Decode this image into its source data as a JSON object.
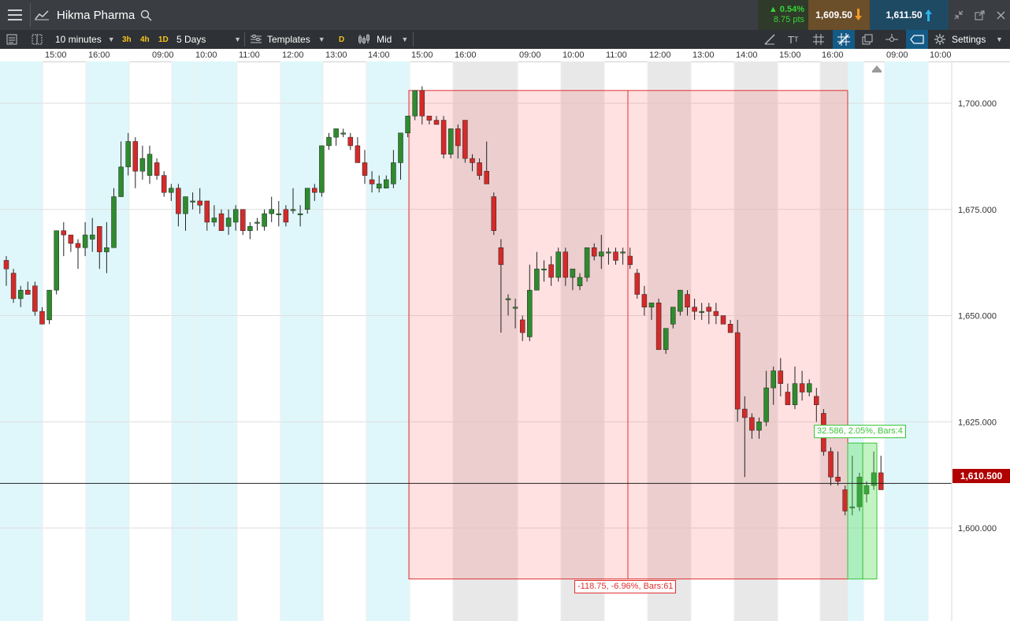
{
  "instrument": {
    "name": "Hikma Pharma"
  },
  "quote": {
    "change_pct": "▲ 0.54%",
    "change_pts": "8.75 pts",
    "bid": "1,609.50",
    "ask": "1,611.50"
  },
  "toolbar": {
    "interval": "10 minutes",
    "quick_3h": "3h",
    "quick_4h": "4h",
    "quick_1d": "1D",
    "period": "5 Days",
    "templates": "Templates",
    "d_badge": "D",
    "price_type": "Mid",
    "settings": "Settings"
  },
  "time_axis": [
    "15:00",
    "16:00",
    "09:00",
    "10:00",
    "11:00",
    "12:00",
    "13:00",
    "14:00",
    "15:00",
    "16:00",
    "09:00",
    "10:00",
    "11:00",
    "12:00",
    "13:00",
    "14:00",
    "15:00",
    "16:00",
    "09:00",
    "10:00"
  ],
  "price_axis": [
    "1,700.000",
    "1,675.000",
    "1,650.000",
    "1,625.000",
    "1,600.000"
  ],
  "current_price": "1,610.500",
  "measurements": {
    "red": "-118.75, -6.96%, Bars:61",
    "green": "32.586, 2.05%, Bars:4"
  },
  "colors": {
    "up": "#2e8b2e",
    "down": "#d42a2a",
    "session_bg": "#dff7fb",
    "measure_red": "#e03030",
    "measure_green": "#39c539",
    "price_tag": "#b00000"
  },
  "chart_data": {
    "type": "candlestick",
    "title": "Hikma Pharma",
    "interval": "10 minutes",
    "ylim": [
      1584,
      1718
    ],
    "y_ticks": [
      1700,
      1675,
      1650,
      1625,
      1600
    ],
    "current_price": 1610.5,
    "candles": [
      [
        1663,
        1664,
        1657,
        1661
      ],
      [
        1660,
        1661,
        1653,
        1654
      ],
      [
        1654,
        1657,
        1652,
        1656
      ],
      [
        1656,
        1658,
        1655,
        1655
      ],
      [
        1657,
        1658,
        1650,
        1651
      ],
      [
        1651,
        1652,
        1648,
        1648
      ],
      [
        1649,
        1656,
        1648,
        1656
      ],
      [
        1656,
        1670,
        1655,
        1670
      ],
      [
        1670,
        1672,
        1664,
        1669
      ],
      [
        1669,
        1669,
        1665,
        1667
      ],
      [
        1667,
        1668,
        1661,
        1666
      ],
      [
        1666,
        1672,
        1664,
        1669
      ],
      [
        1668,
        1673,
        1665,
        1669
      ],
      [
        1671,
        1671,
        1661,
        1665
      ],
      [
        1665,
        1672,
        1660,
        1666
      ],
      [
        1666,
        1680,
        1666,
        1678
      ],
      [
        1678,
        1691,
        1678,
        1685
      ],
      [
        1685,
        1693,
        1683,
        1691
      ],
      [
        1691,
        1692,
        1680,
        1684
      ],
      [
        1684,
        1690,
        1682,
        1687
      ],
      [
        1683,
        1690,
        1681,
        1688
      ],
      [
        1686,
        1687,
        1682,
        1683
      ],
      [
        1683,
        1684,
        1678,
        1679
      ],
      [
        1679,
        1681,
        1677,
        1680
      ],
      [
        1680,
        1681,
        1671,
        1674
      ],
      [
        1674,
        1678,
        1670,
        1678
      ],
      [
        1677,
        1679,
        1675,
        1677
      ],
      [
        1677,
        1680,
        1674,
        1676
      ],
      [
        1677,
        1677,
        1670,
        1672
      ],
      [
        1672,
        1676,
        1671,
        1673
      ],
      [
        1674,
        1675,
        1670,
        1670
      ],
      [
        1671,
        1675,
        1669,
        1673
      ],
      [
        1672,
        1676,
        1670,
        1675
      ],
      [
        1675,
        1675,
        1669,
        1670
      ],
      [
        1670,
        1672,
        1668,
        1671
      ],
      [
        1672,
        1673,
        1670,
        1672
      ],
      [
        1671,
        1675,
        1670,
        1674
      ],
      [
        1674,
        1678,
        1672,
        1675
      ],
      [
        1674,
        1677,
        1671,
        1674
      ],
      [
        1675,
        1676,
        1671,
        1672
      ],
      [
        1675,
        1680,
        1674,
        1675
      ],
      [
        1674,
        1676,
        1671,
        1674
      ],
      [
        1675,
        1680,
        1674,
        1680
      ],
      [
        1680,
        1681,
        1677,
        1679
      ],
      [
        1679,
        1688,
        1678,
        1690
      ],
      [
        1690,
        1693,
        1689,
        1692
      ],
      [
        1692,
        1693,
        1690,
        1694
      ],
      [
        1693,
        1694,
        1692,
        1693
      ],
      [
        1692,
        1693,
        1689,
        1690
      ],
      [
        1690,
        1692,
        1686,
        1686
      ],
      [
        1686,
        1689,
        1681,
        1683
      ],
      [
        1682,
        1684,
        1679,
        1681
      ],
      [
        1680,
        1683,
        1679,
        1681
      ],
      [
        1680,
        1683,
        1680,
        1682
      ],
      [
        1681,
        1689,
        1680,
        1686
      ],
      [
        1686,
        1690,
        1682,
        1693
      ],
      [
        1693,
        1697,
        1692,
        1697
      ],
      [
        1697,
        1703,
        1696,
        1703
      ],
      [
        1703,
        1704,
        1695,
        1697
      ],
      [
        1697,
        1697,
        1695,
        1696
      ],
      [
        1696,
        1697,
        1695,
        1695
      ],
      [
        1696,
        1697,
        1687,
        1688
      ],
      [
        1688,
        1694,
        1687,
        1694
      ],
      [
        1694,
        1695,
        1687,
        1690
      ],
      [
        1696,
        1696,
        1686,
        1687
      ],
      [
        1687,
        1688,
        1684,
        1686
      ],
      [
        1686,
        1687,
        1682,
        1683
      ],
      [
        1684,
        1691,
        1681,
        1681
      ],
      [
        1678,
        1679,
        1669,
        1670
      ],
      [
        1666,
        1668,
        1646,
        1662
      ],
      [
        1654,
        1655,
        1650,
        1654
      ],
      [
        1652,
        1654,
        1647,
        1652
      ],
      [
        1649,
        1650,
        1644,
        1646
      ],
      [
        1645,
        1662,
        1644,
        1656
      ],
      [
        1656,
        1665,
        1656,
        1661
      ],
      [
        1661,
        1663,
        1658,
        1661
      ],
      [
        1662,
        1664,
        1657,
        1659
      ],
      [
        1659,
        1666,
        1658,
        1665
      ],
      [
        1665,
        1666,
        1657,
        1659
      ],
      [
        1659,
        1661,
        1656,
        1661
      ],
      [
        1657,
        1660,
        1656,
        1659
      ],
      [
        1659,
        1666,
        1658,
        1666
      ],
      [
        1666,
        1667,
        1663,
        1664
      ],
      [
        1664,
        1669,
        1661,
        1665
      ],
      [
        1665,
        1666,
        1662,
        1665
      ],
      [
        1665,
        1666,
        1662,
        1663
      ],
      [
        1665,
        1666,
        1662,
        1665
      ],
      [
        1664,
        1666,
        1661,
        1662
      ],
      [
        1660,
        1661,
        1654,
        1655
      ],
      [
        1655,
        1657,
        1650,
        1652
      ],
      [
        1652,
        1653,
        1649,
        1653
      ],
      [
        1653,
        1654,
        1642,
        1642
      ],
      [
        1642,
        1646,
        1641,
        1647
      ],
      [
        1648,
        1652,
        1647,
        1652
      ],
      [
        1651,
        1655,
        1650,
        1656
      ],
      [
        1655,
        1656,
        1650,
        1652
      ],
      [
        1652,
        1654,
        1649,
        1651
      ],
      [
        1651,
        1653,
        1649,
        1651
      ],
      [
        1652,
        1653,
        1648,
        1651
      ],
      [
        1651,
        1653,
        1648,
        1650
      ],
      [
        1650,
        1650,
        1648,
        1648
      ],
      [
        1648,
        1649,
        1646,
        1646
      ],
      [
        1646,
        1649,
        1625,
        1628
      ],
      [
        1628,
        1631,
        1612,
        1626
      ],
      [
        1626,
        1627,
        1621,
        1623
      ],
      [
        1623,
        1626,
        1621,
        1625
      ],
      [
        1625,
        1637,
        1624,
        1633
      ],
      [
        1633,
        1638,
        1629,
        1637
      ],
      [
        1637,
        1640,
        1631,
        1634
      ],
      [
        1632,
        1634,
        1630,
        1629
      ],
      [
        1629,
        1638,
        1628,
        1634
      ],
      [
        1634,
        1637,
        1630,
        1632
      ],
      [
        1632,
        1635,
        1631,
        1634
      ],
      [
        1631,
        1633,
        1625,
        1629
      ],
      [
        1627,
        1628,
        1617,
        1618
      ],
      [
        1618,
        1619,
        1610,
        1612
      ],
      [
        1612,
        1618,
        1610,
        1611
      ],
      [
        1609,
        1610,
        1603,
        1604
      ],
      [
        1605,
        1617,
        1603,
        1605
      ],
      [
        1605,
        1613,
        1604,
        1612
      ],
      [
        1608,
        1611,
        1606,
        1610
      ],
      [
        1610,
        1618,
        1609,
        1613
      ],
      [
        1613,
        1617,
        1609,
        1609
      ]
    ],
    "measure_red": {
      "from": 1703,
      "to": 1588,
      "label": "-118.75, -6.96%, Bars:61"
    },
    "measure_green": {
      "from": 1588,
      "to": 1620,
      "label": "32.586, 2.05%, Bars:4"
    }
  }
}
